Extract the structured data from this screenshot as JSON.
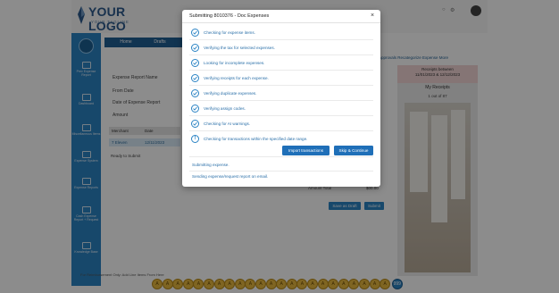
{
  "app": {
    "logo_text": "YOUR LOGO",
    "logo_tagline": "YOUR TAGLINE"
  },
  "sidebar": {
    "items": [
      {
        "label": "Prev Expense Report",
        "icon": "receipt-icon"
      },
      {
        "label": "Dashboard",
        "icon": "dashboard-icon"
      },
      {
        "label": "Miscellaneous Items",
        "icon": "list-icon"
      },
      {
        "label": "Expense System",
        "icon": "folder-icon"
      },
      {
        "label": "Expense Reports",
        "icon": "report-icon"
      },
      {
        "label": "Cash Expense Report + Request",
        "icon": "cash-icon"
      },
      {
        "label": "Knowledge Base",
        "icon": "book-icon"
      }
    ]
  },
  "main": {
    "tabs": [
      "Home",
      "Drafts"
    ],
    "form_labels": [
      "Expense Report Name",
      "From Date",
      "Date of Expense Report",
      "Amount"
    ],
    "table": {
      "headers": [
        "Merchant",
        "Date"
      ],
      "rows": [
        [
          "7 Eleven",
          "12/11/2023"
        ]
      ]
    },
    "status": "Ready to Submit",
    "right_links": "Approvals  Recategorize Expense  More",
    "total_label": "Amount Total",
    "total_value": "$00.00",
    "buttons": {
      "save_draft": "Save as Draft",
      "submit": "Submit"
    },
    "footer_text": "For Reimbursement Only: Add Line Items From Here"
  },
  "receipts": {
    "header_line1": "Receipts between",
    "header_line2": "11/01/2023 & 12/12/2023",
    "title": "My Receipts",
    "pager": "1 out of 87"
  },
  "modal": {
    "title": "Submitting 8010376 - Doc Expenses",
    "close": "×",
    "checks": [
      "Checking for expense items.",
      "Verifying the tax for selected expenses.",
      "Looking for incomplete expenses.",
      "Verifying receipts for each expense.",
      "Verifying duplicate expenses.",
      "Verifying assign codes.",
      "Checking for AI warnings."
    ],
    "info_text": "Checking for transactions within the specified date range.",
    "import_button": "Import transactions",
    "skip_button": "Skip & Continue",
    "status_submitting": "Submitting expense.",
    "status_sending": "Sending expense/request report on email."
  },
  "bottom_bar": {
    "items": [
      "A",
      "A",
      "A",
      "A",
      "A",
      "A",
      "A",
      "A",
      "A",
      "A",
      "A",
      "A",
      "A",
      "A",
      "A",
      "A",
      "A",
      "A",
      "A",
      "A",
      "A",
      "A",
      "A"
    ],
    "last_label": "999"
  },
  "colors": {
    "accent": "#2a83c4",
    "button": "#1f6fb8",
    "check_text": "#2a6fa8"
  }
}
